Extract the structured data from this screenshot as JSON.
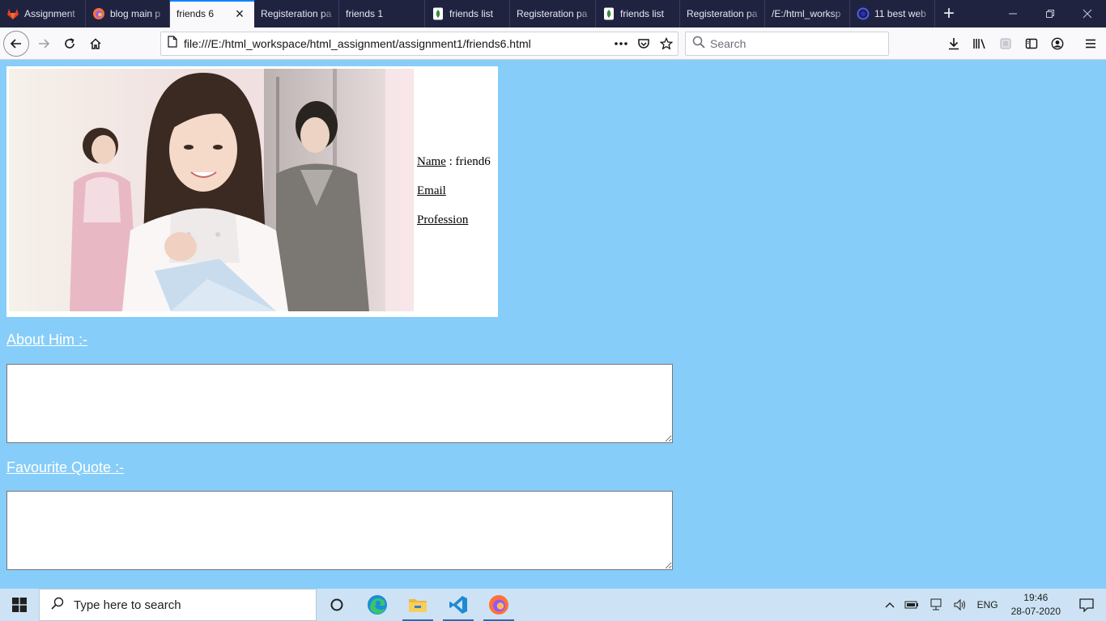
{
  "browser": {
    "tabs": [
      {
        "title": "Assignment",
        "icon": "gitlab-icon",
        "active": false
      },
      {
        "title": "blog main p",
        "icon": "firefox-icon",
        "active": false
      },
      {
        "title": "friends 6",
        "icon": "",
        "active": true
      },
      {
        "title": "Registeration pa",
        "icon": "",
        "active": false
      },
      {
        "title": "friends 1",
        "icon": "",
        "active": false
      },
      {
        "title": "friends list",
        "icon": "page-leaf-icon",
        "active": false
      },
      {
        "title": "Registeration pa",
        "icon": "",
        "active": false
      },
      {
        "title": "friends list",
        "icon": "page-leaf-icon",
        "active": false
      },
      {
        "title": "Registeration pa",
        "icon": "",
        "active": false
      },
      {
        "title": "/E:/html_worksp",
        "icon": "",
        "active": false
      },
      {
        "title": "11 best web",
        "icon": "circle-icon",
        "active": false
      }
    ],
    "url": "file:///E:/html_workspace/html_assignment/assignment1/friends6.html",
    "search_placeholder": "Search",
    "colors": {
      "tabbar": "#202340",
      "active_tab": "#f9f9fb",
      "active_tab_line": "#0a84ff"
    }
  },
  "page": {
    "background": "#87cdf9",
    "profile": {
      "name_label": "Name",
      "name_value": " : friend6",
      "email_label": "Email",
      "profession_label": "Profession"
    },
    "about_heading": "About Him :-",
    "quote_heading": "Favourite Quote :-"
  },
  "taskbar": {
    "search_placeholder": "Type here to search",
    "apps": [
      "cortana-icon",
      "edge-icon",
      "file-explorer-icon",
      "vscode-icon",
      "firefox-icon"
    ],
    "language": "ENG",
    "time": "19:46",
    "date": "28-07-2020"
  }
}
